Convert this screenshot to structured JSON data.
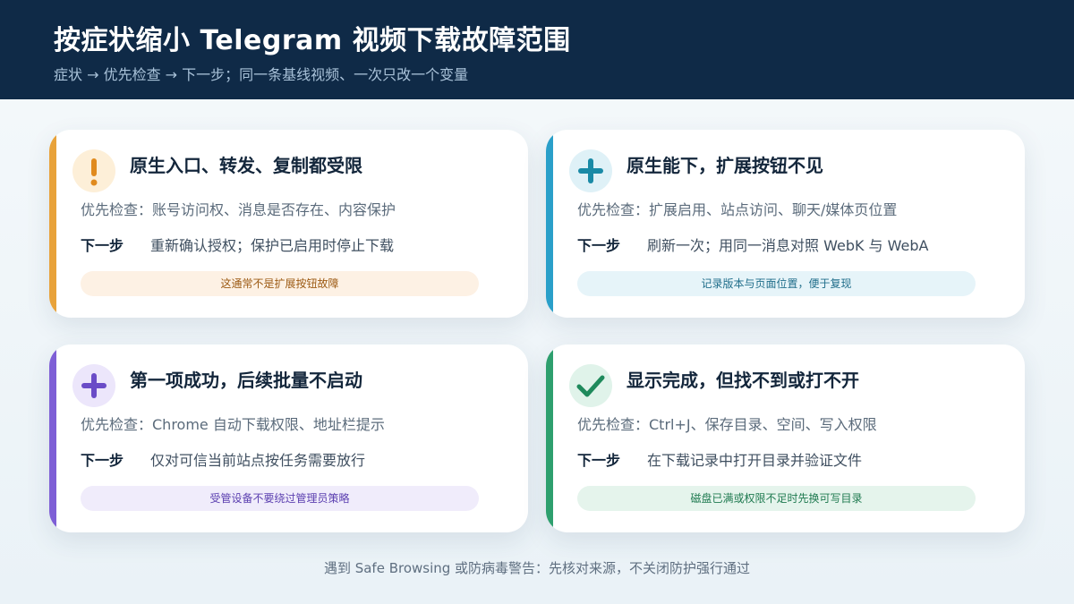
{
  "header": {
    "title": "按症状缩小 Telegram 视频下载故障范围",
    "subtitle": "症状 → 优先检查 → 下一步；同一条基线视频、一次只改一个变量"
  },
  "cards": [
    {
      "title": "原生入口、转发、复制都受限",
      "check": "优先检查：账号访问权、消息是否存在、内容保护",
      "next_label": "下一步",
      "next_text": "重新确认授权；保护已启用时停止下载",
      "note": "这通常不是扩展按钮故障",
      "icon": "exclamation-icon",
      "accent_color": "#e8a23a",
      "icon_bg": "#fdefd8",
      "icon_color": "#e08a1e",
      "note_bg": "#fdf1e4",
      "note_color": "#9c5a13"
    },
    {
      "title": "原生能下，扩展按钮不见",
      "check": "优先检查：扩展启用、站点访问、聊天/媒体页位置",
      "next_label": "下一步",
      "next_text": "刷新一次；用同一消息对照 WebK 与 WebA",
      "note": "记录版本与页面位置，便于复现",
      "icon": "plus-icon",
      "accent_color": "#2a9fc9",
      "icon_bg": "#dff1f7",
      "icon_color": "#1a8aa6",
      "note_bg": "#e6f4f9",
      "note_color": "#1f6d8a"
    },
    {
      "title": "第一项成功，后续批量不启动",
      "check": "优先检查：Chrome 自动下载权限、地址栏提示",
      "next_label": "下一步",
      "next_text": "仅对可信当前站点按任务需要放行",
      "note": "受管设备不要绕过管理员策略",
      "icon": "plus-icon",
      "accent_color": "#7e5fd6",
      "icon_bg": "#ece6fb",
      "icon_color": "#6a4cc7",
      "note_bg": "#f0ecfb",
      "note_color": "#5b3fb0"
    },
    {
      "title": "显示完成，但找不到或打不开",
      "check": "优先检查：Ctrl+J、保存目录、空间、写入权限",
      "next_label": "下一步",
      "next_text": "在下载记录中打开目录并验证文件",
      "note": "磁盘已满或权限不足时先换可写目录",
      "icon": "checkmark-icon",
      "accent_color": "#2e9f6e",
      "icon_bg": "#e0f3ea",
      "icon_color": "#1f8a5c",
      "note_bg": "#e5f4ec",
      "note_color": "#1f7a50"
    }
  ],
  "footer": "遇到 Safe Browsing 或防病毒警告：先核对来源，不关闭防护强行通过"
}
